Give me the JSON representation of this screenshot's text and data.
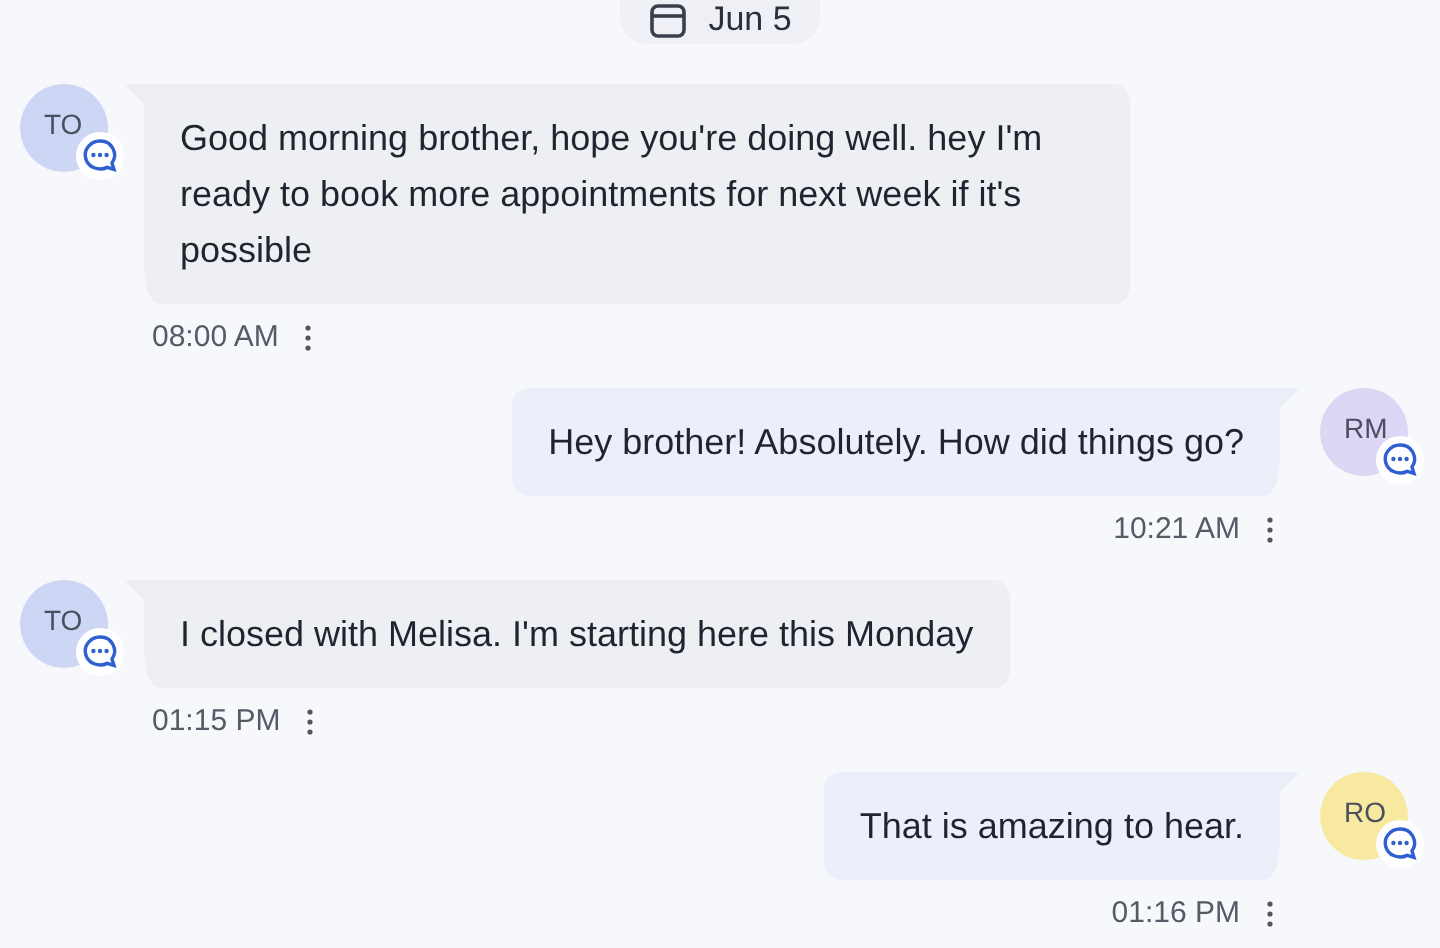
{
  "date_chip": {
    "label": "Jun 5"
  },
  "messages": [
    {
      "kind": "incoming",
      "avatar": {
        "initials": "TO",
        "color": "#cdd6f5"
      },
      "text": "Good morning brother, hope you're doing well. hey I'm ready to book more appointments for next week if it's possible",
      "time": "08:00 AM"
    },
    {
      "kind": "outgoing",
      "avatar": {
        "initials": "RM",
        "color": "#ddd6f5"
      },
      "text": "Hey brother! Absolutely. How did things go?",
      "time": "10:21 AM"
    },
    {
      "kind": "incoming",
      "avatar": {
        "initials": "TO",
        "color": "#cdd6f5"
      },
      "text": "I closed with Melisa. I'm starting here this Monday",
      "time": "01:15 PM"
    },
    {
      "kind": "outgoing",
      "avatar": {
        "initials": "RO",
        "color": "#f8e9a1"
      },
      "text": "That is amazing to hear.",
      "time": "01:16 PM"
    }
  ]
}
